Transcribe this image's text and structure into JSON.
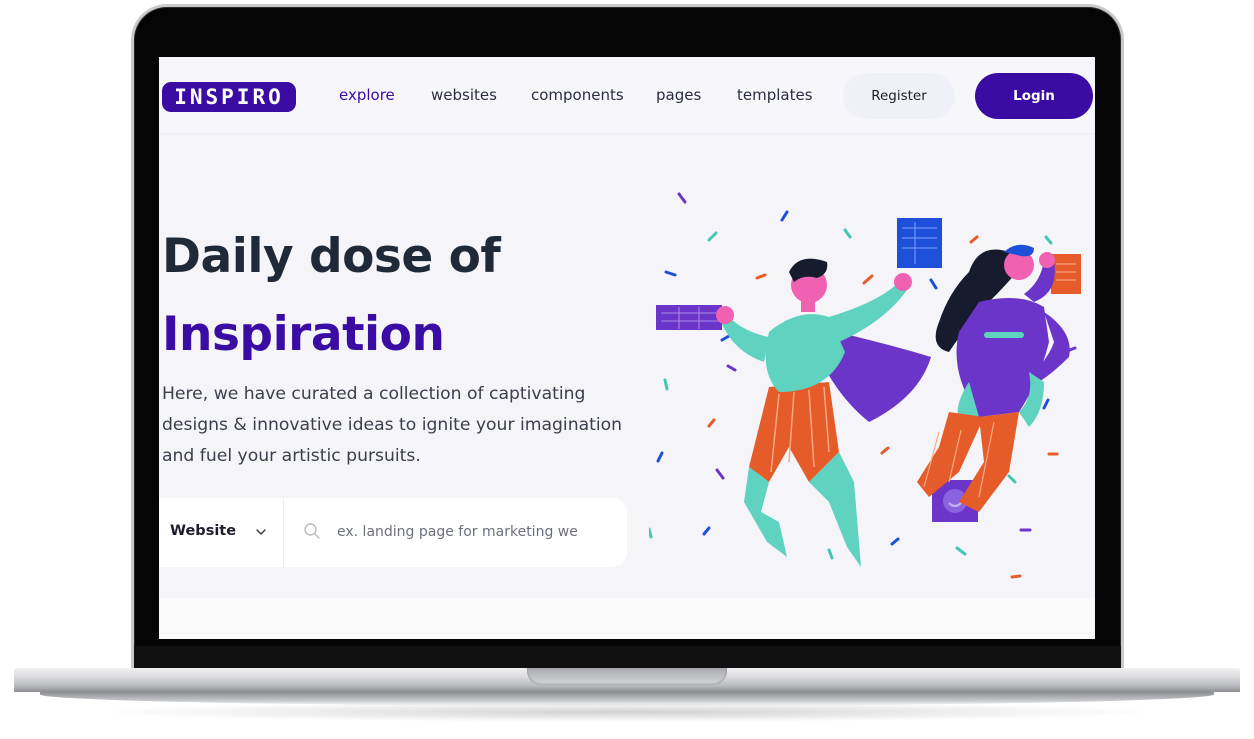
{
  "brand": {
    "logo_text": "INSPIRO"
  },
  "nav": {
    "links": [
      {
        "label": "explore",
        "active": true
      },
      {
        "label": "websites",
        "active": false
      },
      {
        "label": "components",
        "active": false
      },
      {
        "label": "pages",
        "active": false
      },
      {
        "label": "templates",
        "active": false
      }
    ],
    "register_label": "Register",
    "login_label": "Login"
  },
  "hero": {
    "title_line1": "Daily dose of",
    "title_line2": "Inspiration",
    "description": "Here, we have curated a collection of captivating designs & innovative ideas to ignite your imagination and fuel your artistic pursuits."
  },
  "search": {
    "type_selected": "Website",
    "placeholder": "ex. landing page for marketing we",
    "value": ""
  },
  "icons": {
    "search": "search-icon",
    "chevron": "chevron-down-icon"
  },
  "colors": {
    "brand": "#3a0ca3",
    "heading": "#1f2937",
    "background": "#f4f4f9"
  }
}
